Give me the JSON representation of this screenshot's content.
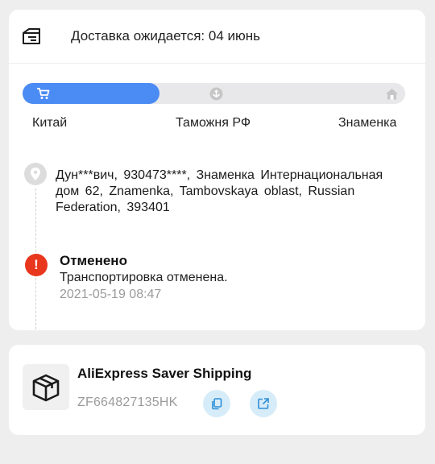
{
  "delivery": {
    "title": "Доставка ожидается: 04 июнь",
    "progress_fraction": 0.33,
    "stages": [
      {
        "label": "Китай",
        "icon": "cart-icon",
        "active": true
      },
      {
        "label": "Таможня РФ",
        "icon": "customs-icon",
        "active": false
      },
      {
        "label": "Знаменка",
        "icon": "home-icon",
        "active": false
      }
    ],
    "address": "Дун***вич,  930473****,  Знаменка Интернациональная дом 62,  Znamenka,  Tambovskaya oblast,  Russian Federation,  393401"
  },
  "event": {
    "status": "Отменено",
    "description": "Транспортировка отменена.",
    "timestamp": "2021-05-19 08:47",
    "status_color": "#e8371d"
  },
  "shipping": {
    "carrier": "AliExpress Saver Shipping",
    "tracking_number": "ZF664827135HK",
    "actions": [
      "copy-icon",
      "open-link-icon"
    ]
  },
  "colors": {
    "accent": "#4b8bf4",
    "action_bg": "#d6ecf8",
    "action_icon": "#2f8fd6"
  }
}
